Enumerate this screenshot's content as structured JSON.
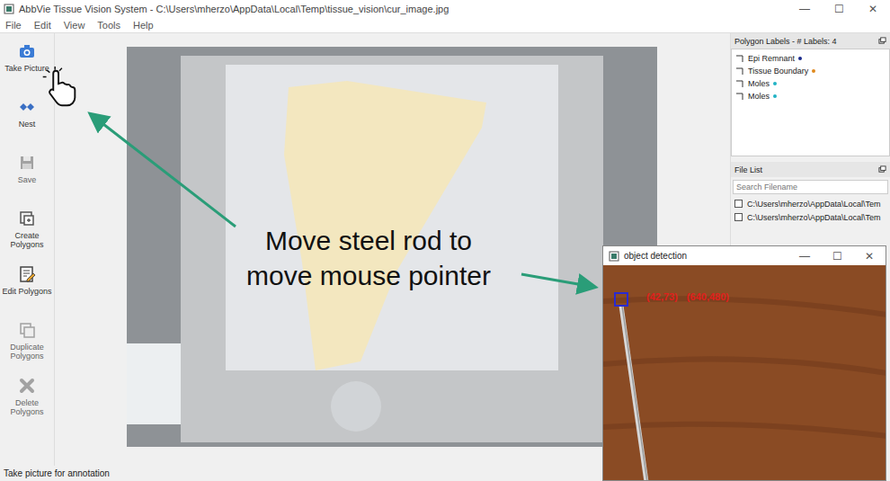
{
  "window": {
    "title": "AbbVie Tissue Vision System - C:\\Users\\mherzo\\AppData\\Local\\Temp\\tissue_vision\\cur_image.jpg",
    "controls": [
      "—",
      "☐",
      "✕"
    ]
  },
  "menu": [
    "File",
    "Edit",
    "View",
    "Tools",
    "Help"
  ],
  "toolbar": [
    {
      "label": "Take Picture",
      "disabled": false
    },
    {
      "label": "Nest",
      "disabled": false
    },
    {
      "label": "Save",
      "disabled": true
    },
    {
      "label": "Create Polygons",
      "disabled": false
    },
    {
      "label": "Edit Polygons",
      "disabled": false
    },
    {
      "label": "Duplicate Polygons",
      "disabled": true
    },
    {
      "label": "Delete Polygons",
      "disabled": true
    }
  ],
  "labels_panel": {
    "title": "Polygon Labels - # Labels: 4",
    "items": [
      {
        "label": "Epi Remnant",
        "color": "#1a2a8c"
      },
      {
        "label": "Tissue Boundary",
        "color": "#e08a1e"
      },
      {
        "label": "Moles",
        "color": "#22b3c4"
      },
      {
        "label": "Moles",
        "color": "#22b3c4"
      }
    ]
  },
  "file_panel": {
    "title": "File List",
    "search": {
      "placeholder": "Search Filename"
    },
    "files": [
      {
        "path": "C:\\Users\\mherzo\\AppData\\Local\\Tem",
        "checked": false
      },
      {
        "path": "C:\\Users\\mherzo\\AppData\\Local\\Tem",
        "checked": false
      }
    ]
  },
  "status_bar": "Take picture for annotation",
  "annotation": {
    "lines": [
      "Move steel rod to",
      "move mouse pointer"
    ]
  },
  "detection_window": {
    "title": "object detection",
    "controls": [
      "—",
      "☐",
      "✕"
    ],
    "readout": [
      "(42,73)",
      "(640,480)"
    ]
  }
}
